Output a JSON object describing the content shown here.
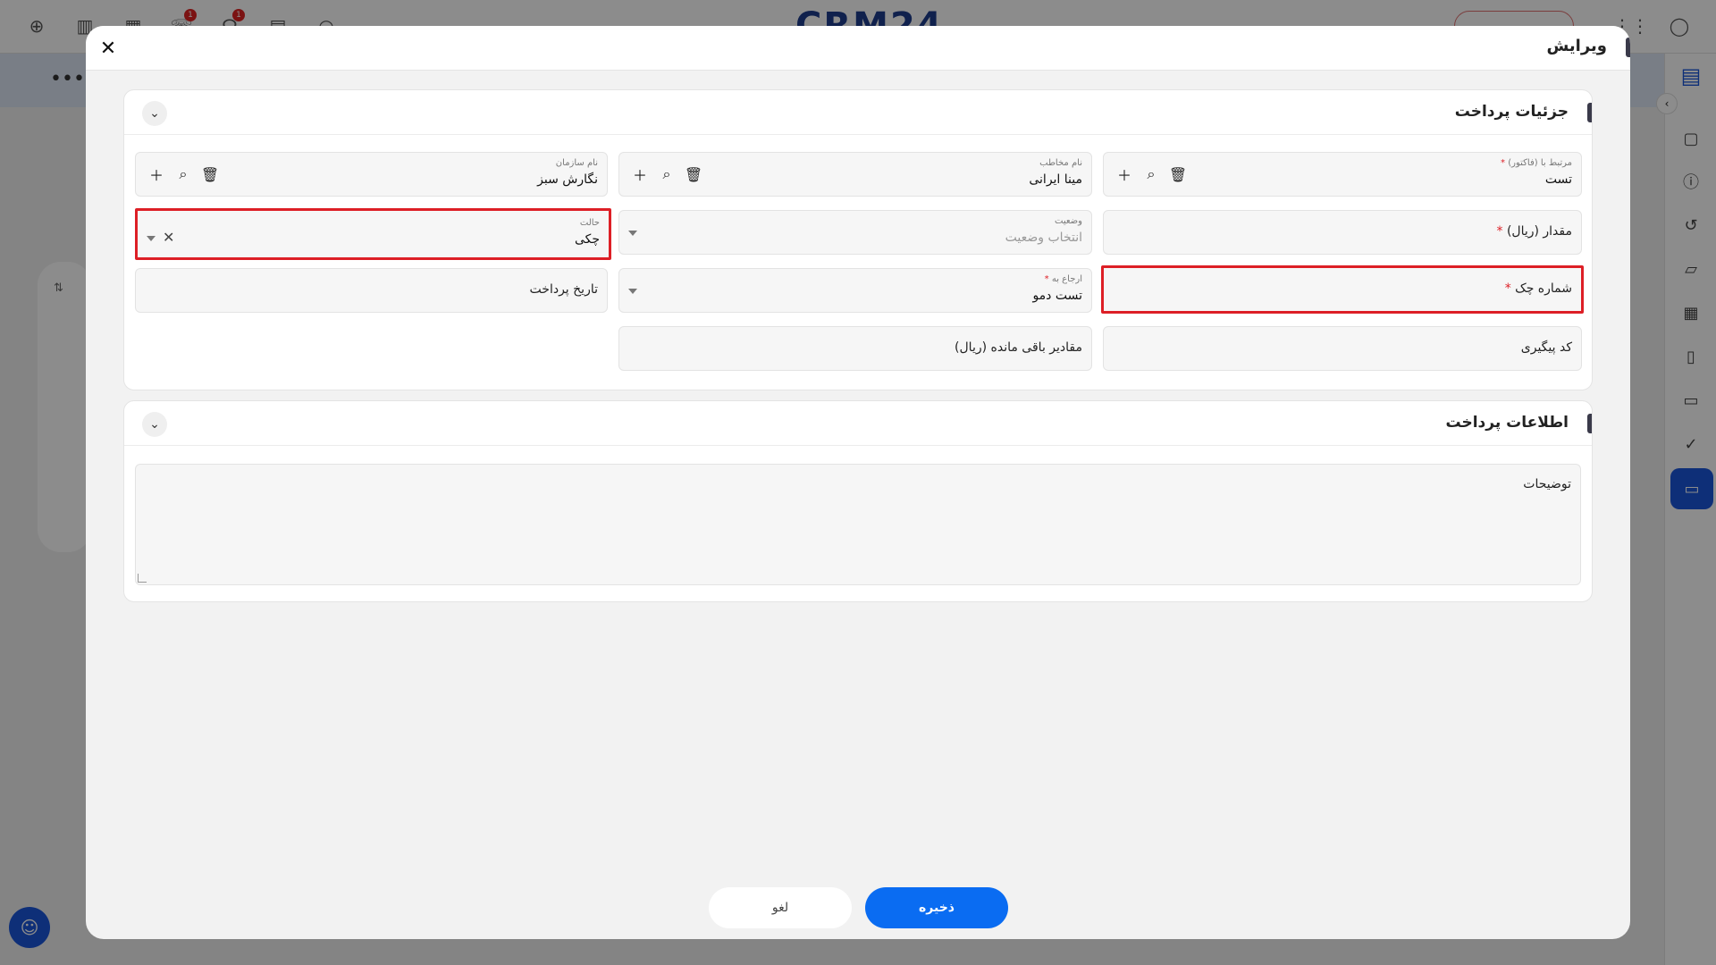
{
  "app": {
    "logo_text": "CRM24",
    "top_button_label": "...",
    "notification_counts": [
      "1",
      "1"
    ]
  },
  "modal": {
    "title": "ویرایش",
    "close_icon": "close-icon"
  },
  "payment_details": {
    "title": "جزئیات پرداخت",
    "related_to": {
      "label": "مرتبط با (فاکتور)",
      "required": "*",
      "value": "تست"
    },
    "contact_name": {
      "label": "نام مخاطب",
      "value": "مینا ایرانی"
    },
    "organization_name": {
      "label": "نام سازمان",
      "value": "نگارش سبز"
    },
    "amount": {
      "label": "مقدار (ریال)",
      "required": "*"
    },
    "status": {
      "label": "وضعیت",
      "placeholder": "انتخاب وضعیت"
    },
    "mode": {
      "label": "حالت",
      "value": "چکی"
    },
    "check_number": {
      "label": "شماره چک",
      "required": "*"
    },
    "assigned_to": {
      "label": "ارجاع به",
      "required": "*",
      "value": "تست دمو"
    },
    "payment_date": {
      "label": "تاریخ پرداخت"
    },
    "tracking_code": {
      "label": "کد پیگیری"
    },
    "remaining_amounts": {
      "label": "مقادیر باقی مانده (ریال)"
    }
  },
  "payment_info": {
    "title": "اطلاعات پرداخت",
    "description": {
      "label": "توضیحات"
    }
  },
  "footer": {
    "save_label": "ذخیره",
    "cancel_label": "لغو"
  },
  "colors": {
    "primary": "#0a6cf2",
    "highlight": "#dd1f26",
    "rail_active": "#1a56db"
  }
}
